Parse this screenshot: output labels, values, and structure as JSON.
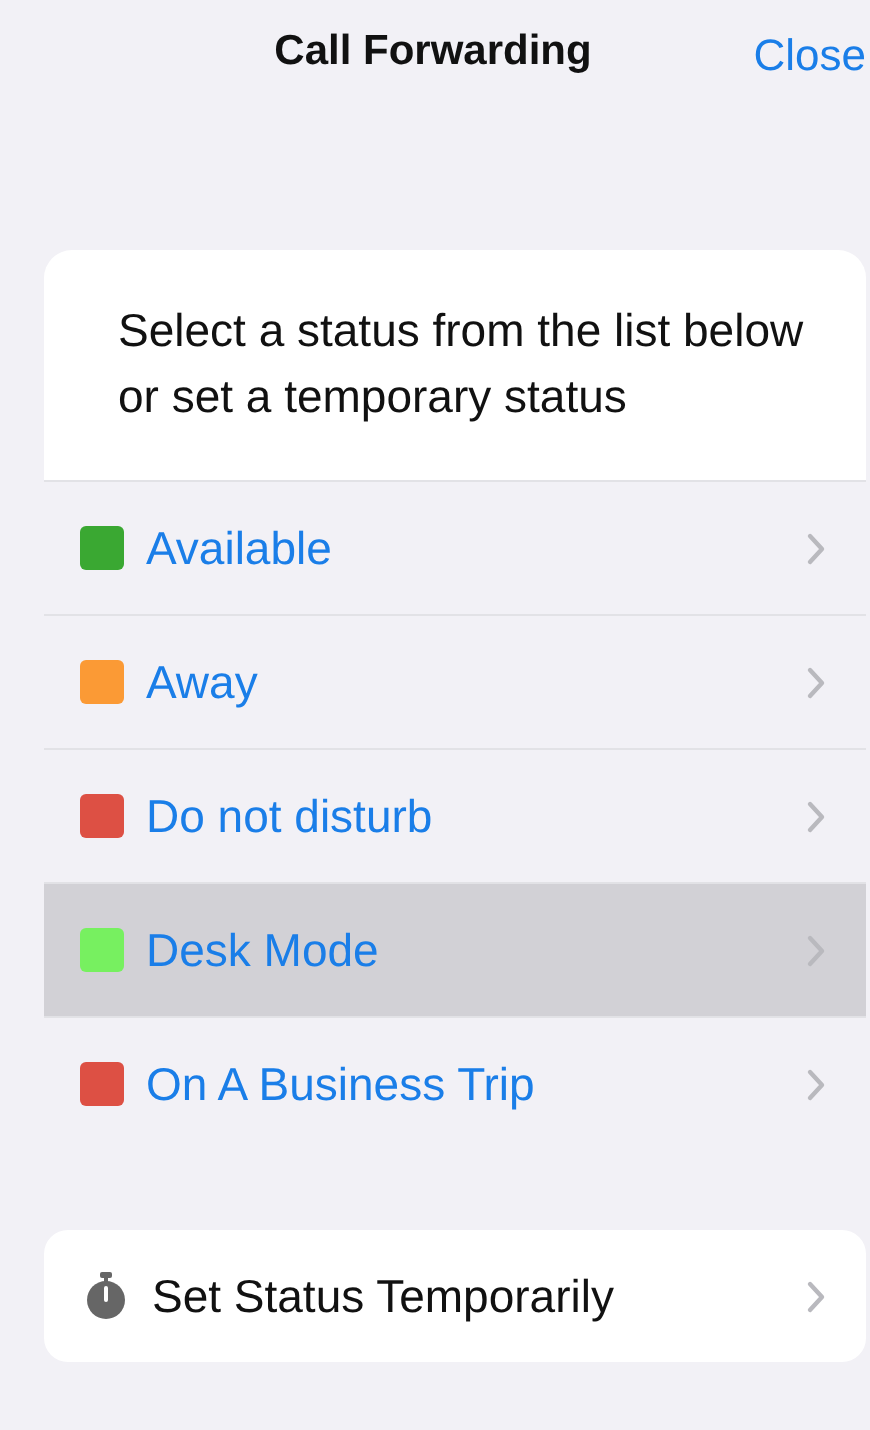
{
  "header": {
    "title": "Call Forwarding",
    "close": "Close"
  },
  "intro": "Select a status from the list below or set a temporary status",
  "statuses": [
    {
      "label": "Available",
      "color": "#3aa832",
      "selected": false
    },
    {
      "label": "Away",
      "color": "#fb9a35",
      "selected": false
    },
    {
      "label": "Do not disturb",
      "color": "#dd5044",
      "selected": false
    },
    {
      "label": "Desk Mode",
      "color": "#77f060",
      "selected": true
    },
    {
      "label": "On A Business Trip",
      "color": "#dd5044",
      "selected": false
    }
  ],
  "temporary": {
    "label": "Set Status Temporarily"
  }
}
